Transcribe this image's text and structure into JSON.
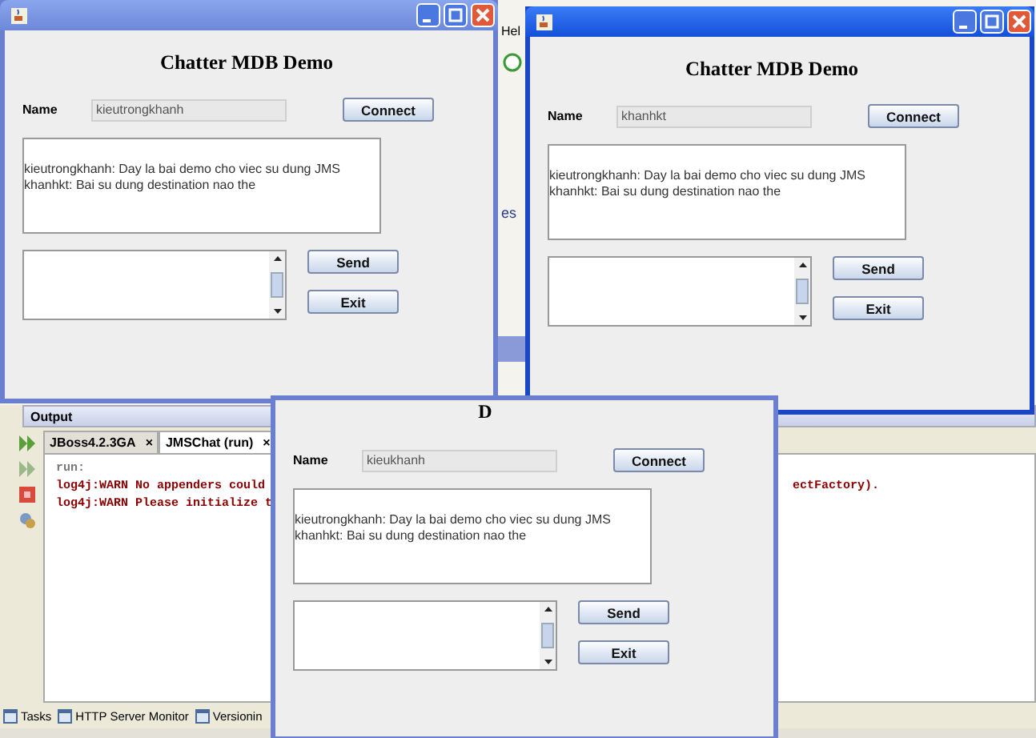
{
  "ide": {
    "menu_fragment": "Hel",
    "editor_fragment": "es",
    "output": {
      "title": "Output",
      "tabs": [
        {
          "label": "JBoss4.2.3GA",
          "close": "×",
          "selected": false
        },
        {
          "label": "JMSChat (run)",
          "close": "×",
          "selected": true
        }
      ],
      "lines": [
        {
          "text": "run:",
          "kind": "info"
        },
        {
          "text": "log4j:WARN No appenders could",
          "kind": "warn",
          "tail": "ectFactory)."
        },
        {
          "text": "log4j:WARN Please initialize t",
          "kind": "warn"
        }
      ]
    },
    "bottom_tabs": [
      "Tasks",
      "HTTP Server Monitor",
      "Versionin"
    ]
  },
  "windows": [
    {
      "title_bar": true,
      "active": false,
      "heading": "Chatter MDB Demo",
      "name_label": "Name",
      "name_value": "kieutrongkhanh",
      "connect": "Connect",
      "messages": [
        "kieutrongkhanh: Day la bai demo cho viec su dung JMS",
        "khanhkt: Bai su dung destination nao the"
      ],
      "send": "Send",
      "exit": "Exit"
    },
    {
      "title_bar": true,
      "active": true,
      "heading": "Chatter MDB Demo",
      "name_label": "Name",
      "name_value": "khanhkt",
      "connect": "Connect",
      "messages": [
        "kieutrongkhanh: Day la bai demo cho viec su dung JMS",
        "khanhkt: Bai su dung destination nao the"
      ],
      "send": "Send",
      "exit": "Exit"
    },
    {
      "title_bar": false,
      "active": false,
      "heading": "D",
      "name_label": "Name",
      "name_value": "kieukhanh",
      "connect": "Connect",
      "messages": [
        "kieutrongkhanh: Day la bai demo cho viec su dung JMS",
        "khanhkt: Bai su dung destination nao the"
      ],
      "send": "Send",
      "exit": "Exit"
    }
  ]
}
